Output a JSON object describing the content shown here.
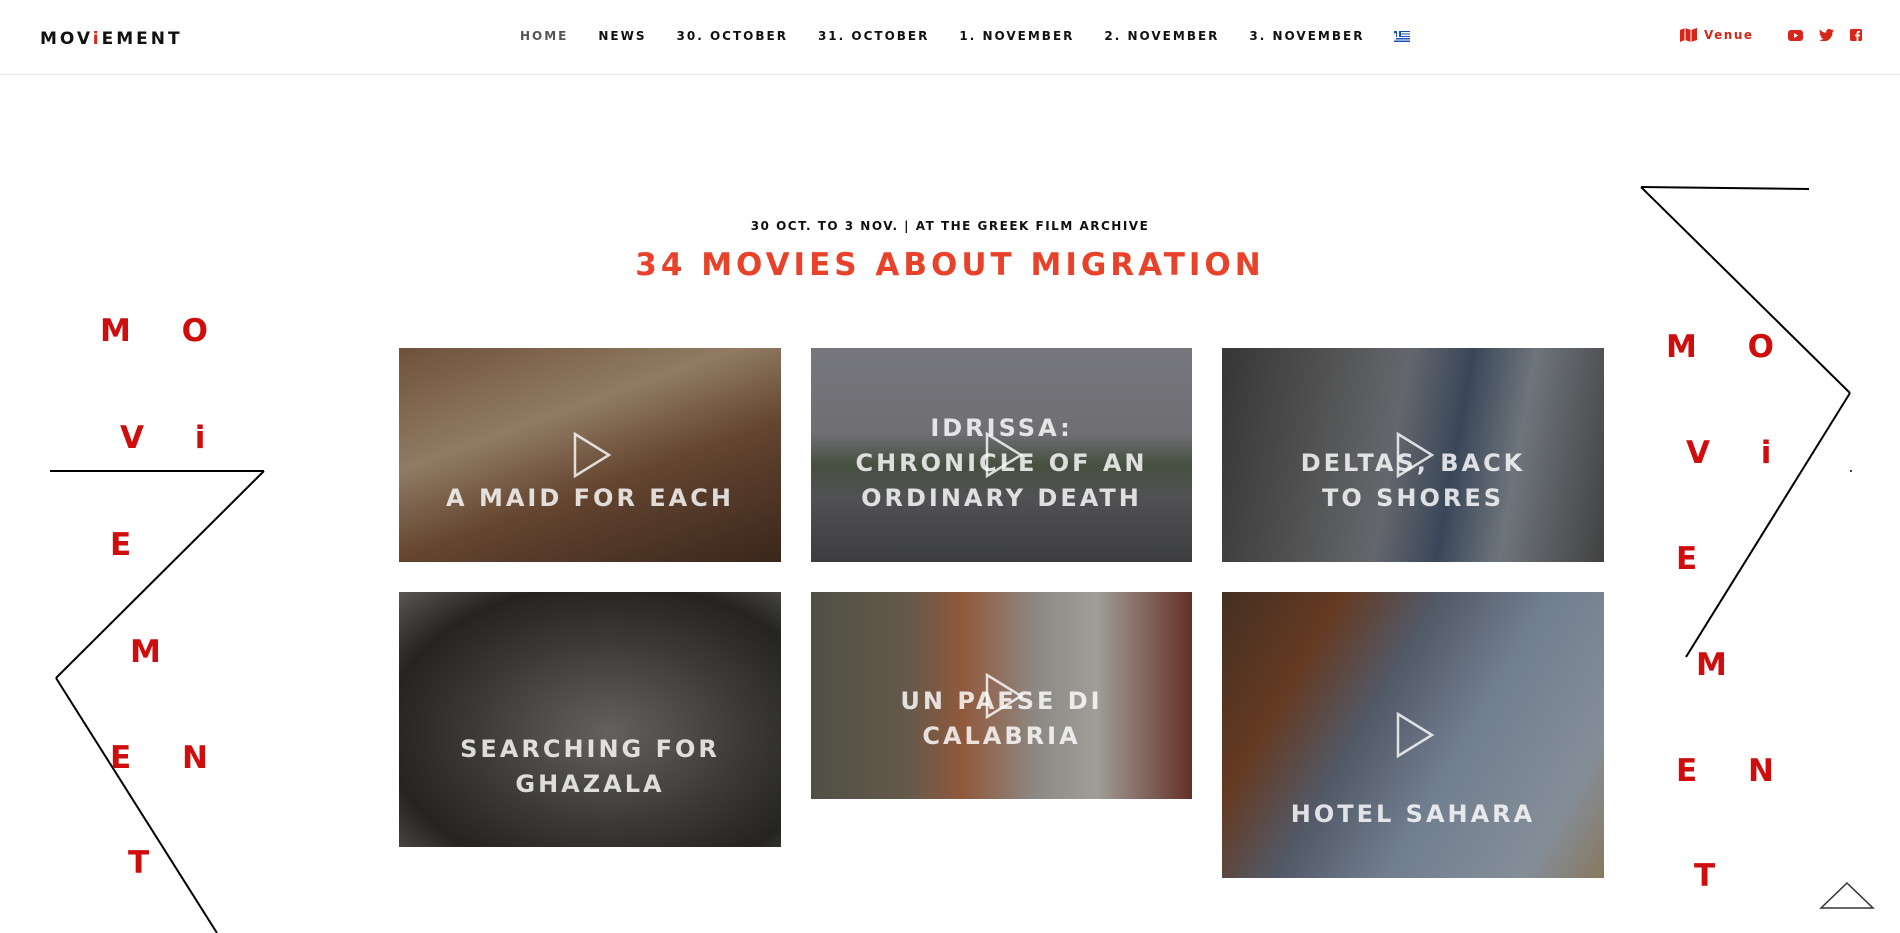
{
  "header": {
    "logo_prefix": "MOV",
    "logo_i": "i",
    "logo_suffix": "EMENT",
    "nav": [
      {
        "label": "HOME"
      },
      {
        "label": "NEWS"
      },
      {
        "label": "30. OCTOBER"
      },
      {
        "label": "31. OCTOBER"
      },
      {
        "label": "1. NOVEMBER"
      },
      {
        "label": "2. NOVEMBER"
      },
      {
        "label": "3. NOVEMBER"
      }
    ],
    "flag_icon": "greek-flag-icon",
    "venue_label": "Venue",
    "social_icons": [
      "youtube-icon",
      "twitter-icon",
      "facebook-icon"
    ]
  },
  "hero": {
    "subtitle": "30 OCT. TO 3 NOV. | AT THE GREEK FILM ARCHIVE",
    "title": "34 MOVIES ABOUT MIGRATION"
  },
  "movies": [
    {
      "title": "A MAID FOR EACH"
    },
    {
      "title": "IDRISSA: CHRONICLE OF AN ORDINARY DEATH"
    },
    {
      "title": "DELTAS, BACK TO SHORES"
    },
    {
      "title": "SEARCHING FOR GHAZALA"
    },
    {
      "title": "UN PAESE DI CALABRIA"
    },
    {
      "title": "HOTEL SAHARA"
    }
  ],
  "decor": {
    "left": [
      "M O",
      "V i",
      "E",
      "M",
      "E N",
      "T"
    ],
    "right": [
      "M O",
      "V i",
      "E",
      "M",
      "E N",
      "T"
    ]
  },
  "colors": {
    "accent": "#e8432a",
    "decor_red": "#d00d0d"
  }
}
